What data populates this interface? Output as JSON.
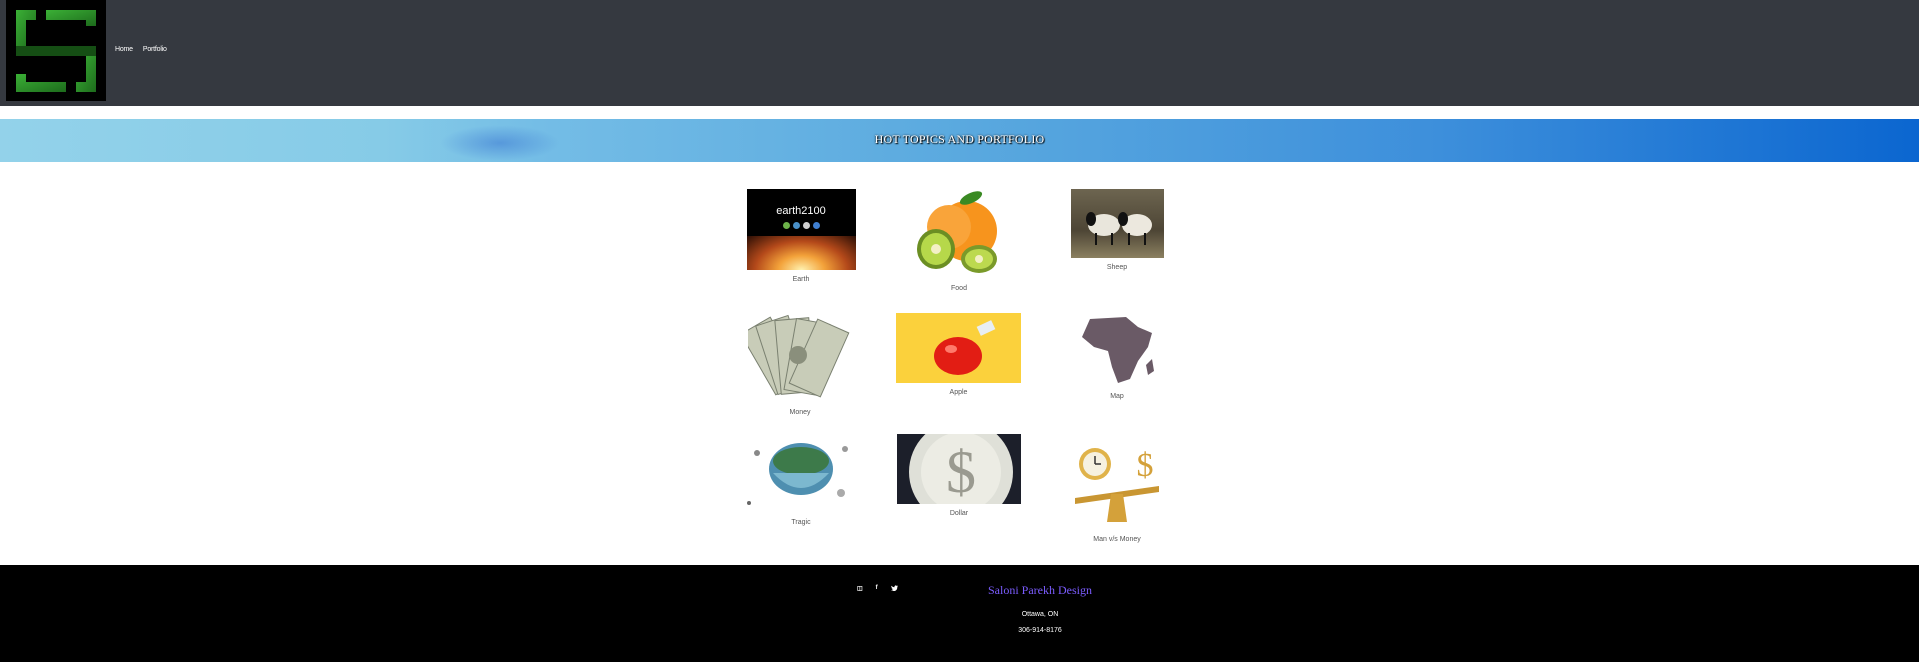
{
  "header": {
    "nav": [
      {
        "label": "Home"
      },
      {
        "label": "Portfolio"
      }
    ]
  },
  "banner": {
    "title": "HOT TOPICS AND PORTFOLIO"
  },
  "gallery": {
    "items": [
      {
        "caption": "Earth",
        "image_text": "earth2100"
      },
      {
        "caption": "Food"
      },
      {
        "caption": "Sheep"
      },
      {
        "caption": "Money"
      },
      {
        "caption": "Apple"
      },
      {
        "caption": "Map"
      },
      {
        "caption": "Tragic"
      },
      {
        "caption": "Dollar"
      },
      {
        "caption": "Man v/s Money"
      }
    ]
  },
  "footer": {
    "social": [
      {
        "icon": "instagram-icon",
        "glyph": "◫"
      },
      {
        "icon": "facebook-icon",
        "glyph": "f"
      },
      {
        "icon": "twitter-icon",
        "glyph": "🐦"
      }
    ],
    "brand": "Saloni Parekh Design",
    "location": "Ottawa, ON",
    "phone": "306-914-8176"
  },
  "colors": {
    "header_bg": "#353940",
    "footer_bg": "#000000",
    "brand": "#7b5cff",
    "logo_green": "#2f9a2a"
  }
}
